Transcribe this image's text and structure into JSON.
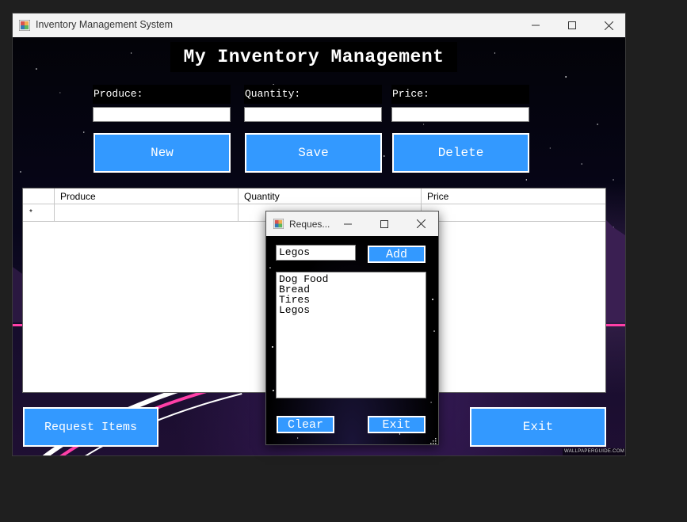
{
  "main_window": {
    "title": "Inventory Management System",
    "heading": "My Inventory Management",
    "fields": {
      "produce_label": "Produce:",
      "quantity_label": "Quantity:",
      "price_label": "Price:",
      "produce_value": "",
      "quantity_value": "",
      "price_value": ""
    },
    "buttons": {
      "new": "New",
      "save": "Save",
      "delete": "Delete",
      "request_items": "Request Items",
      "exit": "Exit"
    },
    "grid": {
      "columns": [
        "Produce",
        "Quantity",
        "Price"
      ],
      "new_row_marker": "*",
      "rows": []
    },
    "watermark": "WALLPAPERGUIDE.COM"
  },
  "request_dialog": {
    "title": "Reques...",
    "input_value": "Legos",
    "add_label": "Add",
    "items": [
      "Dog Food",
      "Bread",
      "Tires",
      "Legos"
    ],
    "clear_label": "Clear",
    "exit_label": "Exit"
  },
  "colors": {
    "button_blue": "#3399ff",
    "titlebar": "#f3f3f3",
    "desktop": "#1f1f1f"
  }
}
